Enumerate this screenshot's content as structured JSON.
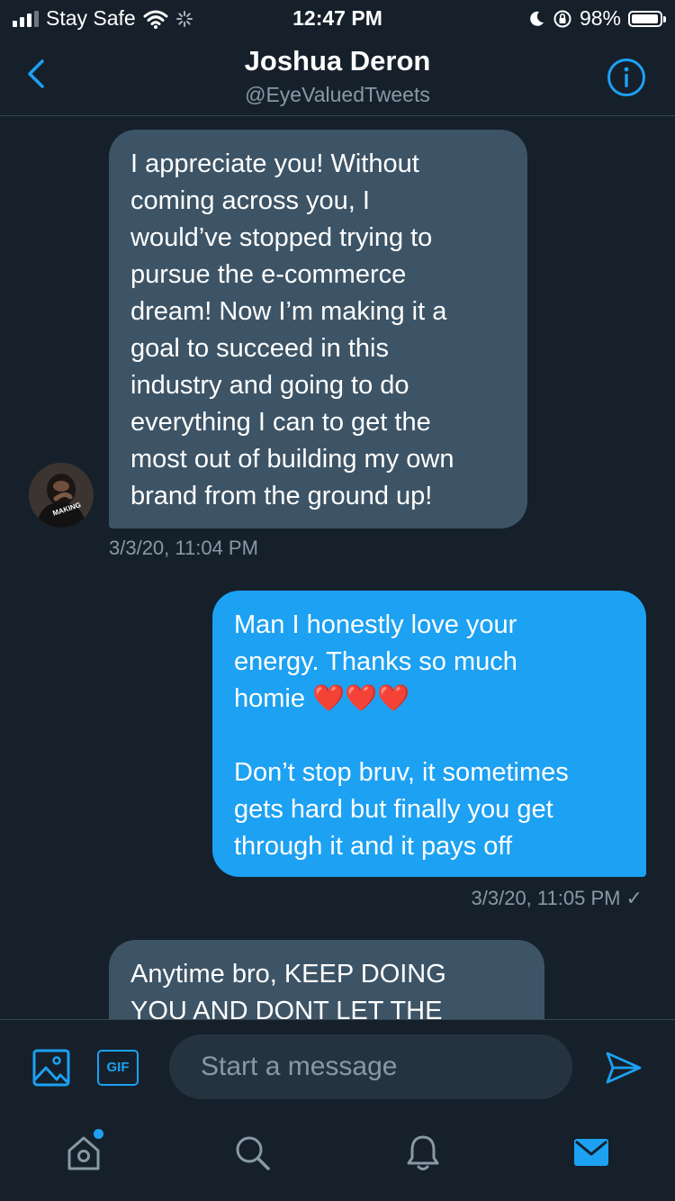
{
  "status_bar": {
    "carrier": "Stay Safe",
    "time": "12:47 PM",
    "battery_percent": "98%",
    "battery_level": 0.98
  },
  "header": {
    "name": "Joshua Deron",
    "handle": "@EyeValuedTweets"
  },
  "messages": [
    {
      "direction": "received",
      "text": "I appreciate you! Without\ncoming across you, I\nwould’ve stopped trying to\npursue the e-commerce\ndream! Now I’m making it a\ngoal to succeed in this\nindustry and going to do\neverything I can to get the\nmost out of building my own\nbrand from the ground up!",
      "timestamp": "3/3/20, 11:04 PM"
    },
    {
      "direction": "sent",
      "text": "Man I honestly love your\nenergy. Thanks so much\nhomie ❤️❤️❤️\n\nDon’t stop bruv, it sometimes\ngets hard but finally you get\nthrough it and it pays off",
      "timestamp": "3/3/20, 11:05 PM ✓"
    },
    {
      "direction": "received",
      "text": "Anytime bro, KEEP DOING\nYOU AND DONT LET THE"
    }
  ],
  "avatar_caption": "MAKING",
  "composer": {
    "gif_label": "GIF",
    "placeholder": "Start a message"
  },
  "colors": {
    "background": "#15202b",
    "accent": "#1da1f2",
    "received_bubble": "#3d5466",
    "secondary_text": "#8899a6"
  }
}
